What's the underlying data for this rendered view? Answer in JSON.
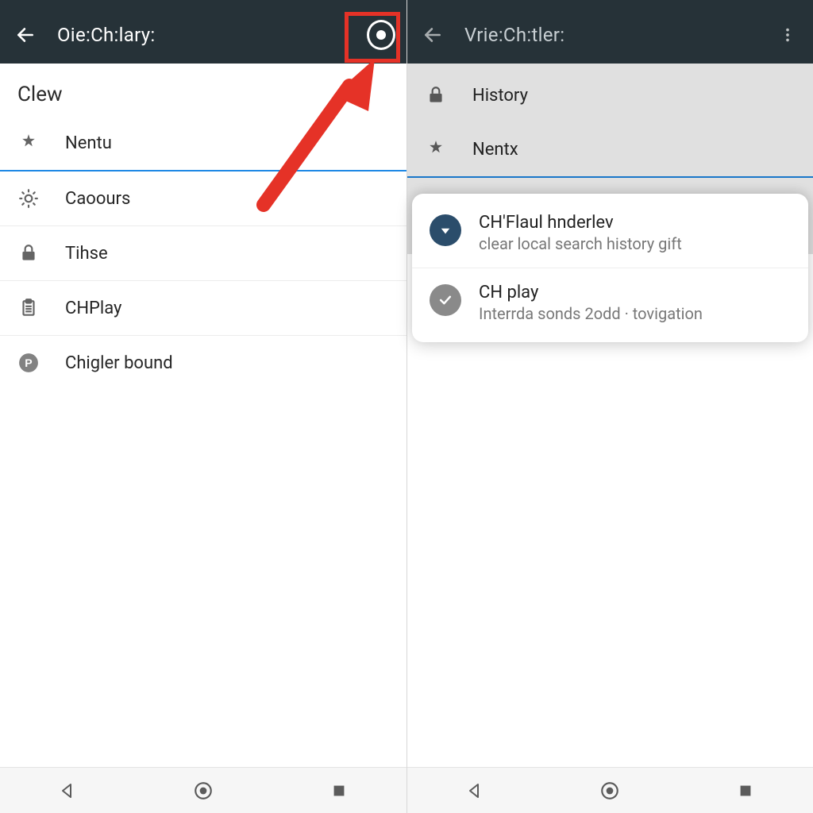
{
  "colors": {
    "appbar": "#263238",
    "accent": "#1e88e5",
    "highlight": "#e53227"
  },
  "left": {
    "title": "Oie:Ch:lary:",
    "section": "Clew",
    "items": [
      {
        "icon": "asterisk",
        "label": "Nentu",
        "active": true
      },
      {
        "icon": "sun",
        "label": "Caoours"
      },
      {
        "icon": "lock",
        "label": "Tihse"
      },
      {
        "icon": "clipboard",
        "label": "CHPlay"
      },
      {
        "icon": "p-circle",
        "label": "Chigler bound"
      }
    ]
  },
  "right": {
    "title": "Vrie:Ch:tler:",
    "items": [
      {
        "icon": "lock",
        "label": "History"
      },
      {
        "icon": "asterisk",
        "label": "Nentx",
        "active": true
      }
    ],
    "sheet": [
      {
        "icon": "down-tri",
        "color": "blue",
        "title": "CH'Flaul hnderlev",
        "sub": "clear local search history gift"
      },
      {
        "icon": "check",
        "color": "grey",
        "title": "CH play",
        "sub": "Interrda sonds 2odd · tovigation"
      }
    ]
  }
}
